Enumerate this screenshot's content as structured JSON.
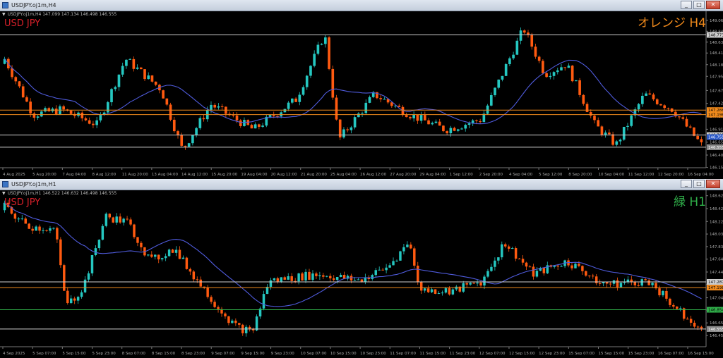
{
  "colors": {
    "bull": "#25c7c0",
    "bear": "#ff5a10",
    "ma": "#4f5bdc",
    "orange": "#f08a1c",
    "green": "#30b04a",
    "red": "#d8202a",
    "white": "#cfcfcf"
  },
  "windows": [
    {
      "id": "w1",
      "title": "USDJPY.oj1m,H4",
      "info": "USDJPY.oj1m,H4  147.099 147.134 146.498 146.555",
      "symbol_label": "USD JPY",
      "tf_label": "オレンジ H4",
      "tf_color": "orange",
      "buttons": [
        "_",
        "□",
        "✕"
      ],
      "chart_data": {
        "type": "candlestick",
        "ylim": [
          146.15,
          149.1
        ],
        "y_ticks": [
          "149.060",
          "148.845",
          "148.630",
          "148.415",
          "148.185",
          "147.955",
          "147.675",
          "147.420",
          "147.165",
          "146.910",
          "146.655",
          "146.400",
          "146.155"
        ],
        "y_tick_values": [
          149.06,
          148.845,
          148.63,
          148.415,
          148.185,
          147.955,
          147.675,
          147.42,
          147.165,
          146.91,
          146.655,
          146.4,
          146.155
        ],
        "x_ticks": [
          "4 Aug 2025",
          "5 Aug 20:00",
          "7 Aug 04:00",
          "8 Aug 12:00",
          "11 Aug 20:00",
          "13 Aug 04:00",
          "14 Aug 12:00",
          "15 Aug 20:00",
          "19 Aug 04:00",
          "20 Aug 12:00",
          "21 Aug 20:00",
          "25 Aug 04:00",
          "26 Aug 12:00",
          "27 Aug 20:00",
          "29 Aug 04:00",
          "1 Sep 12:00",
          "2 Sep 20:00",
          "4 Sep 04:00",
          "5 Sep 12:00",
          "8 Sep 20:00",
          "10 Sep 04:00",
          "11 Sep 12:00",
          "12 Sep 20:00",
          "16 Sep 04:00"
        ],
        "hlines": [
          {
            "price": 148.773,
            "color": "white",
            "label": "148.773"
          },
          {
            "price": 147.288,
            "color": "orange",
            "label": "147.288"
          },
          {
            "price": 147.198,
            "color": "orange",
            "label": "147.198"
          },
          {
            "price": 146.795,
            "color": "white",
            "label": "146.795"
          },
          {
            "price": 146.555,
            "color": "white",
            "label": "146.555"
          }
        ],
        "price_labels": [
          {
            "price": 146.755,
            "label": "146.755",
            "bg": "#2a58c8"
          },
          {
            "price": 146.555,
            "label": "146.555",
            "bg": "#8a8a8a"
          }
        ],
        "seed": 7,
        "count": 190,
        "start": 148.2,
        "ma_period": 20,
        "waypoints": [
          [
            0,
            148.3
          ],
          [
            8,
            147.2
          ],
          [
            16,
            147.3
          ],
          [
            26,
            147.0
          ],
          [
            34,
            148.3
          ],
          [
            44,
            147.7
          ],
          [
            50,
            146.5
          ],
          [
            58,
            147.4
          ],
          [
            70,
            146.9
          ],
          [
            82,
            147.5
          ],
          [
            90,
            148.8
          ],
          [
            94,
            146.7
          ],
          [
            104,
            147.6
          ],
          [
            114,
            147.2
          ],
          [
            124,
            146.9
          ],
          [
            134,
            147.1
          ],
          [
            146,
            148.9
          ],
          [
            152,
            148.0
          ],
          [
            158,
            148.2
          ],
          [
            166,
            147.0
          ],
          [
            172,
            146.6
          ],
          [
            180,
            147.6
          ],
          [
            188,
            147.3
          ],
          [
            196,
            146.6
          ]
        ]
      }
    },
    {
      "id": "w2",
      "title": "USDJPY.oj1m,H1",
      "info": "USDJPY.oj1m,H1  146.522 146.632 146.498 146.555",
      "symbol_label": "USD JPY",
      "tf_label": "緑 H1",
      "tf_color": "green",
      "buttons": [
        "_",
        "□",
        "✕"
      ],
      "chart_data": {
        "type": "candlestick",
        "ylim": [
          146.28,
          148.6
        ],
        "y_ticks": [
          "148.625",
          "148.425",
          "148.225",
          "148.030",
          "147.835",
          "147.640",
          "147.440",
          "147.245",
          "147.040",
          "146.850",
          "146.650",
          "146.455",
          "146.255"
        ],
        "y_tick_values": [
          148.625,
          148.425,
          148.225,
          148.03,
          147.835,
          147.64,
          147.44,
          147.245,
          147.04,
          146.85,
          146.65,
          146.455,
          146.255
        ],
        "x_ticks": [
          "4 Sep 2025",
          "5 Sep 07:00",
          "5 Sep 15:00",
          "5 Sep 23:00",
          "8 Sep 07:00",
          "8 Sep 15:00",
          "8 Sep 23:00",
          "9 Sep 07:00",
          "9 Sep 15:00",
          "9 Sep 23:00",
          "10 Sep 07:00",
          "10 Sep 15:00",
          "10 Sep 23:00",
          "11 Sep 07:00",
          "11 Sep 15:00",
          "11 Sep 23:00",
          "12 Sep 07:00",
          "12 Sep 15:00",
          "12 Sep 23:00",
          "15 Sep 07:00",
          "15 Sep 15:00",
          "15 Sep 23:00",
          "16 Sep 07:00",
          "16 Sep 15:00"
        ],
        "hlines": [
          {
            "price": 147.287,
            "color": "white",
            "label": "147.287"
          },
          {
            "price": 147.198,
            "color": "orange",
            "label": "147.198"
          },
          {
            "price": 146.854,
            "color": "green",
            "label": "146.854"
          },
          {
            "price": 146.555,
            "color": "white",
            "label": "146.555"
          }
        ],
        "price_labels": [
          {
            "price": 146.555,
            "label": "146.555",
            "bg": "#8a8a8a"
          }
        ],
        "seed": 19,
        "count": 200,
        "start": 148.4,
        "ma_period": 24,
        "waypoints": [
          [
            0,
            148.45
          ],
          [
            8,
            148.15
          ],
          [
            18,
            148.1
          ],
          [
            22,
            146.9
          ],
          [
            28,
            147.2
          ],
          [
            36,
            148.3
          ],
          [
            44,
            148.2
          ],
          [
            52,
            147.6
          ],
          [
            60,
            147.8
          ],
          [
            74,
            147.0
          ],
          [
            82,
            146.6
          ],
          [
            88,
            146.5
          ],
          [
            94,
            147.3
          ],
          [
            112,
            147.4
          ],
          [
            126,
            147.3
          ],
          [
            136,
            147.5
          ],
          [
            144,
            147.9
          ],
          [
            148,
            147.15
          ],
          [
            160,
            147.15
          ],
          [
            170,
            147.3
          ],
          [
            178,
            147.9
          ],
          [
            188,
            147.4
          ],
          [
            200,
            147.6
          ],
          [
            214,
            147.25
          ],
          [
            230,
            147.3
          ],
          [
            236,
            147.0
          ],
          [
            248,
            146.55
          ]
        ]
      }
    }
  ]
}
